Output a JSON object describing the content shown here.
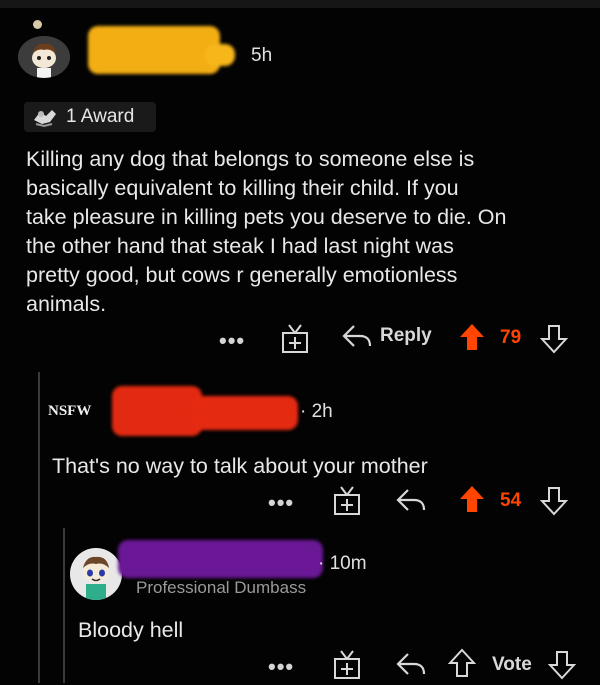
{
  "comments": [
    {
      "age": "5h",
      "award_label": "1 Award",
      "body_lines": [
        "Killing any dog that belongs to someone else is",
        "basically equivalent to killing their child. If you",
        "take pleasure in killing pets you deserve to die. On",
        "the other hand that steak I had last night was",
        "pretty good, but cows r generally emotionless",
        "animals."
      ],
      "actions": {
        "more": "•••",
        "reply": "Reply",
        "score": "79"
      }
    },
    {
      "tag": "NSFW",
      "age": "· 2h",
      "body": "That's no way to talk about your mother",
      "actions": {
        "more": "•••",
        "score": "54"
      }
    },
    {
      "age": "· 10m",
      "flair": "Professional Dumbass",
      "body": "Bloody hell",
      "actions": {
        "more": "•••",
        "vote": "Vote"
      }
    }
  ],
  "colors": {
    "background": "#030303",
    "upvote_active": "#ff4500",
    "redact_yellow": "#f5b014",
    "redact_red": "#e52a12",
    "redact_purple": "#6a1896"
  },
  "icons": [
    "snoo-avatar-icon",
    "award-icon",
    "gift-icon",
    "reply-arrow-icon",
    "upvote-arrow-icon",
    "downvote-arrow-icon"
  ]
}
